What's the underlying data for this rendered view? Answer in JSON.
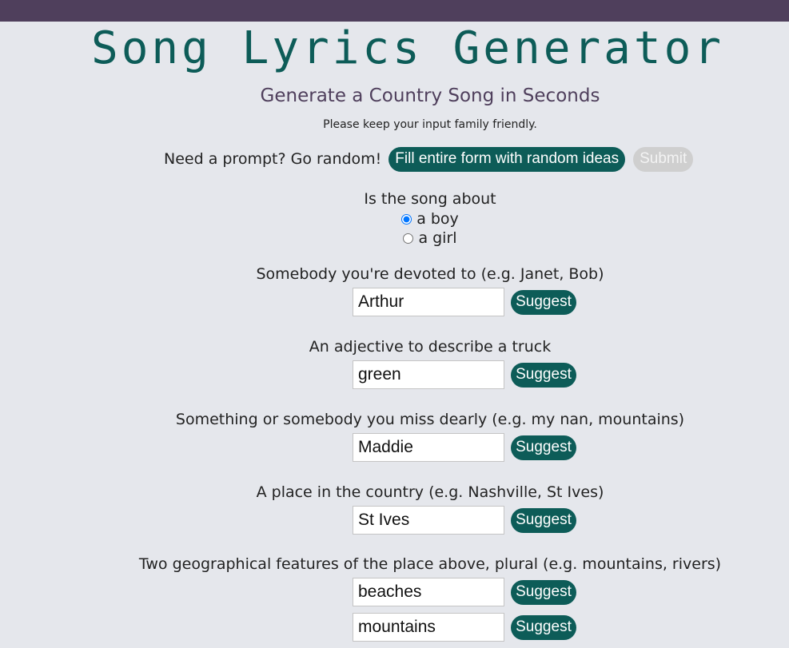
{
  "header": {
    "title": "Song Lyrics Generator",
    "subtitle": "Generate a Country Song in Seconds",
    "note": "Please keep your input family friendly."
  },
  "random": {
    "prompt": "Need a prompt? Go random!",
    "fill_label": "Fill entire form with random ideas",
    "submit_label": "Submit"
  },
  "gender": {
    "question": "Is the song about",
    "options": [
      {
        "label": "a boy",
        "checked": true
      },
      {
        "label": "a girl",
        "checked": false
      }
    ]
  },
  "fields": [
    {
      "label": "Somebody you're devoted to (e.g. Janet, Bob)",
      "values": [
        "Arthur"
      ]
    },
    {
      "label": "An adjective to describe a truck",
      "values": [
        "green"
      ]
    },
    {
      "label": "Something or somebody you miss dearly (e.g. my nan, mountains)",
      "values": [
        "Maddie"
      ]
    },
    {
      "label": "A place in the country (e.g. Nashville, St Ives)",
      "values": [
        "St Ives"
      ]
    },
    {
      "label": "Two geographical features of the place above, plural (e.g. mountains, rivers)",
      "values": [
        "beaches",
        "mountains"
      ]
    }
  ],
  "suggest_label": "Suggest",
  "colors": {
    "top_bar": "#4f3f5c",
    "accent": "#0d5c58",
    "subtitle": "#4f3f5c",
    "background": "#e5e7ec",
    "disabled": "#cfcfcf"
  }
}
